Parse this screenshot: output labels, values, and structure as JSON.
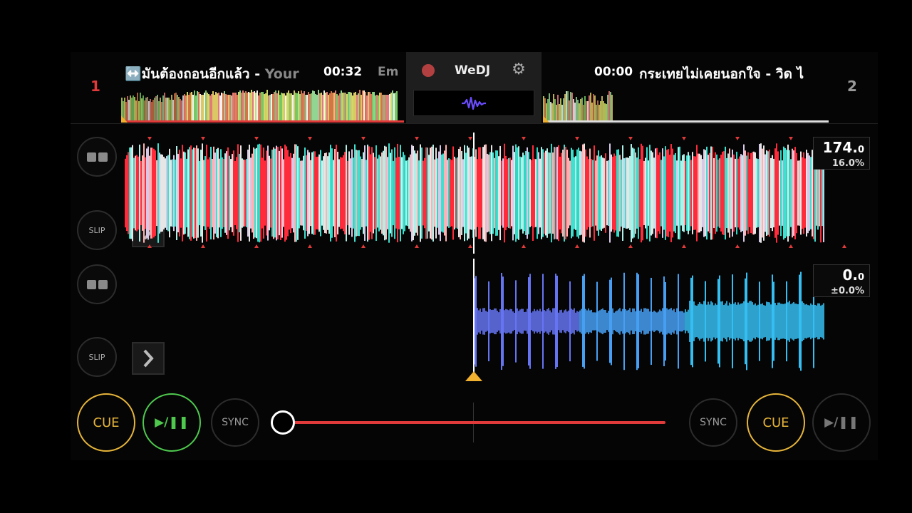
{
  "deck1": {
    "number": "1",
    "title": "↔️มันต้องถอนอีกแล้ว - ",
    "title_fade": "Your",
    "time": "00:32",
    "next_preview": "Em",
    "bpm_int": "174.",
    "bpm_dec": "0",
    "pitch": "16.0%",
    "slip_label": "SLIP",
    "cue_label": "CUE",
    "play_label": "▶/❚❚",
    "sync_label": "SYNC",
    "color": "#e03a3a"
  },
  "deck2": {
    "number": "2",
    "title": "กระเทยไม่เคยนอกใจ - วิด ไ",
    "time": "00:00",
    "bpm_int": "0.",
    "bpm_dec": "0",
    "pitch": "±0.0%",
    "slip_label": "SLIP",
    "cue_label": "CUE",
    "play_label": "▶/❚❚",
    "sync_label": "SYNC"
  },
  "center": {
    "app_name": "WeDJ",
    "record_icon": "record-icon",
    "settings_icon": "gear-icon",
    "view_icon": "waveform-icon"
  },
  "crossfader": {
    "position": 0.0
  },
  "colors": {
    "accent_red": "#e03a3a",
    "cue_yellow": "#e6b43a",
    "play_green": "#4ec94e"
  }
}
